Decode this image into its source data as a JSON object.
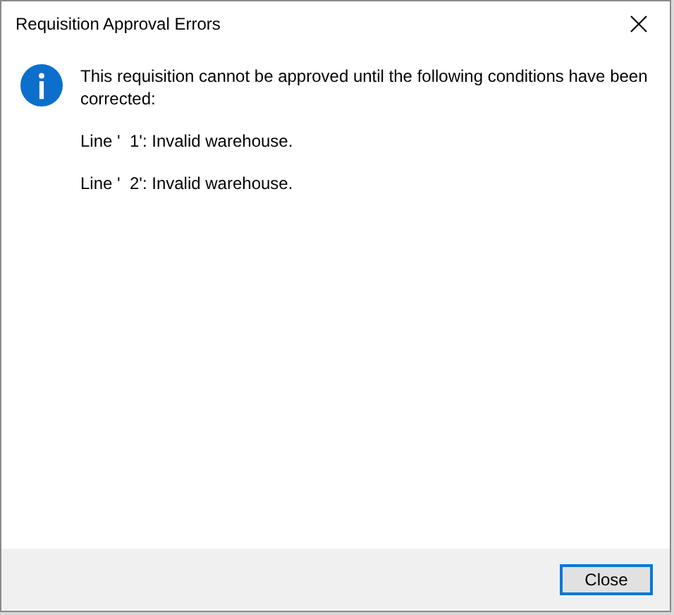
{
  "window": {
    "title": "Requisition Approval Errors"
  },
  "message": "This requisition cannot be approved until the following conditions have been corrected:",
  "errors": [
    "Line '  1': Invalid warehouse.",
    "Line '  2': Invalid warehouse."
  ],
  "buttons": [
    {
      "label": "Close",
      "focused": true
    }
  ]
}
